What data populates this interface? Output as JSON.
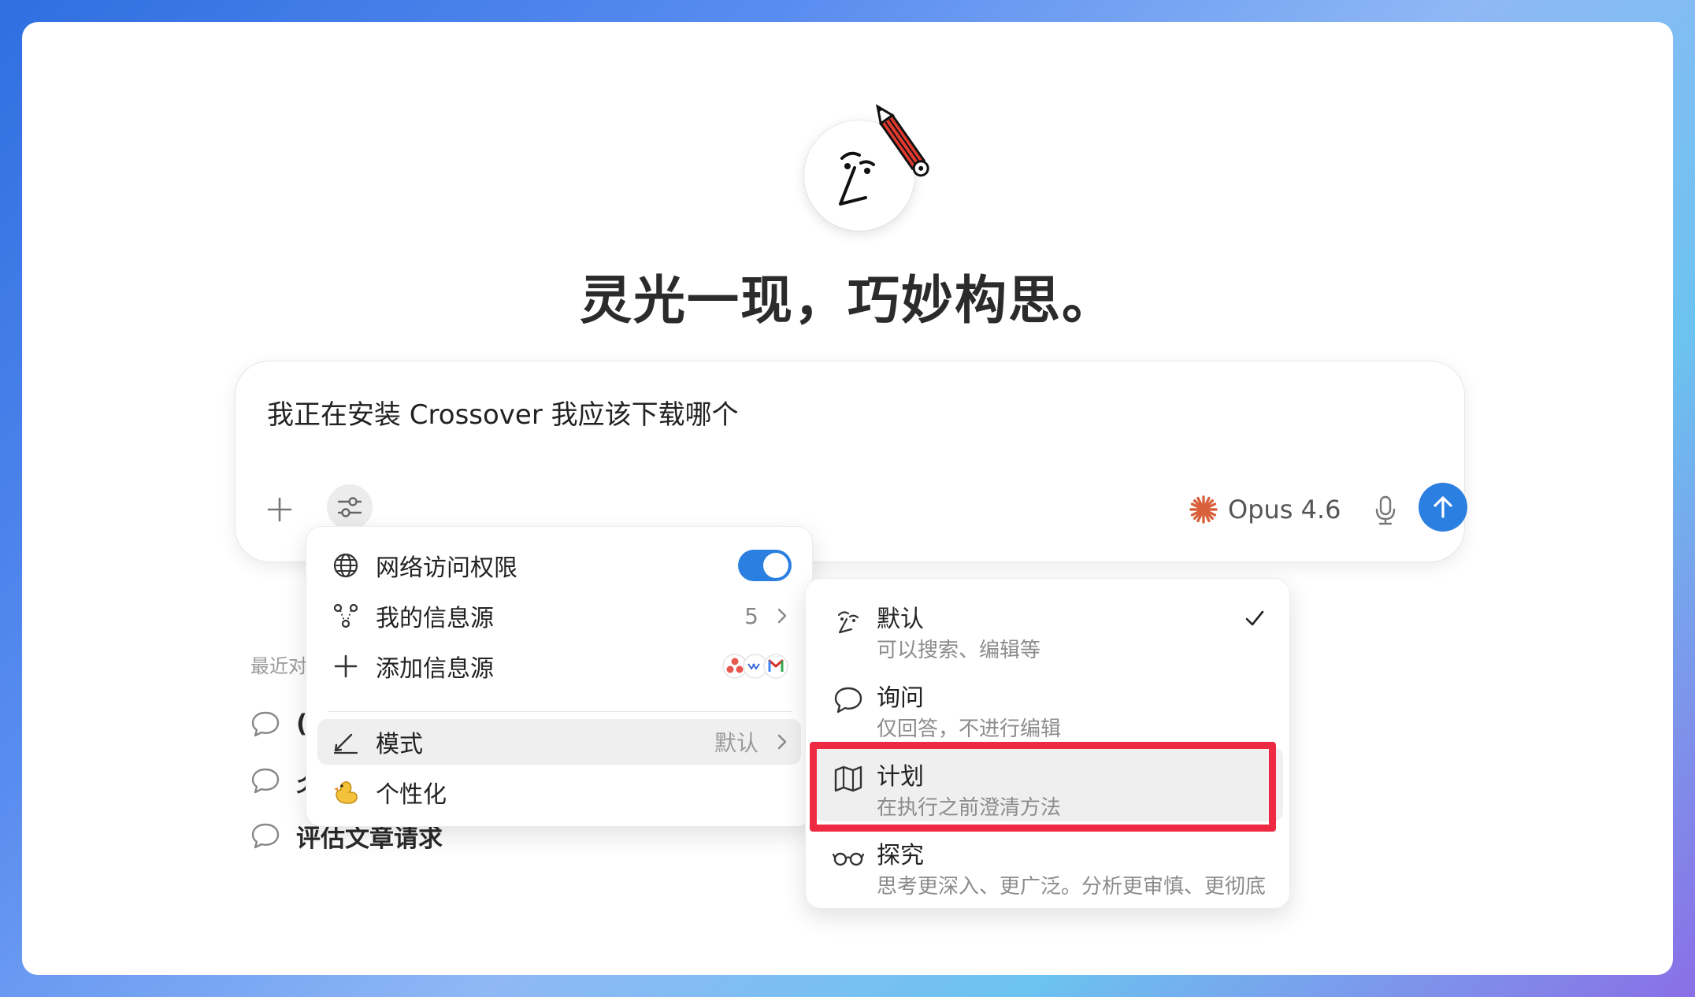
{
  "headline": "灵光一现，巧妙构思。",
  "composer": {
    "text": "我正在安装 Crossover 我应该下载哪个",
    "model": "Opus 4.6"
  },
  "recent": {
    "label": "最近对",
    "items": [
      {
        "label": "("
      },
      {
        "label": "仌"
      },
      {
        "label": "评估文章请求"
      }
    ]
  },
  "menu": {
    "network": {
      "label": "网络访问权限",
      "enabled": true
    },
    "sources": {
      "label": "我的信息源",
      "count": "5"
    },
    "add_source": {
      "label": "添加信息源"
    },
    "mode": {
      "label": "模式",
      "value": "默认"
    },
    "personalize": {
      "label": "个性化"
    }
  },
  "submenu": {
    "default": {
      "title": "默认",
      "desc": "可以搜索、编辑等",
      "selected": true
    },
    "ask": {
      "title": "询问",
      "desc": "仅回答，不进行编辑"
    },
    "plan": {
      "title": "计划",
      "desc": "在执行之前澄清方法"
    },
    "explore": {
      "title": "探究",
      "desc": "思考更深入、更广泛。分析更审慎、更彻底"
    }
  },
  "colors": {
    "accent": "#2b7fe0",
    "highlight": "#ee2a43",
    "claude_orange": "#d9603b"
  },
  "icons": [
    "plus-icon",
    "sliders-icon",
    "sparkle-icon",
    "mic-icon",
    "arrow-up-icon",
    "globe-icon",
    "nodes-icon",
    "pen-icon",
    "duck-icon",
    "chat-bubble-icon",
    "map-icon",
    "glasses-icon",
    "check-icon",
    "chevron-right-icon"
  ]
}
